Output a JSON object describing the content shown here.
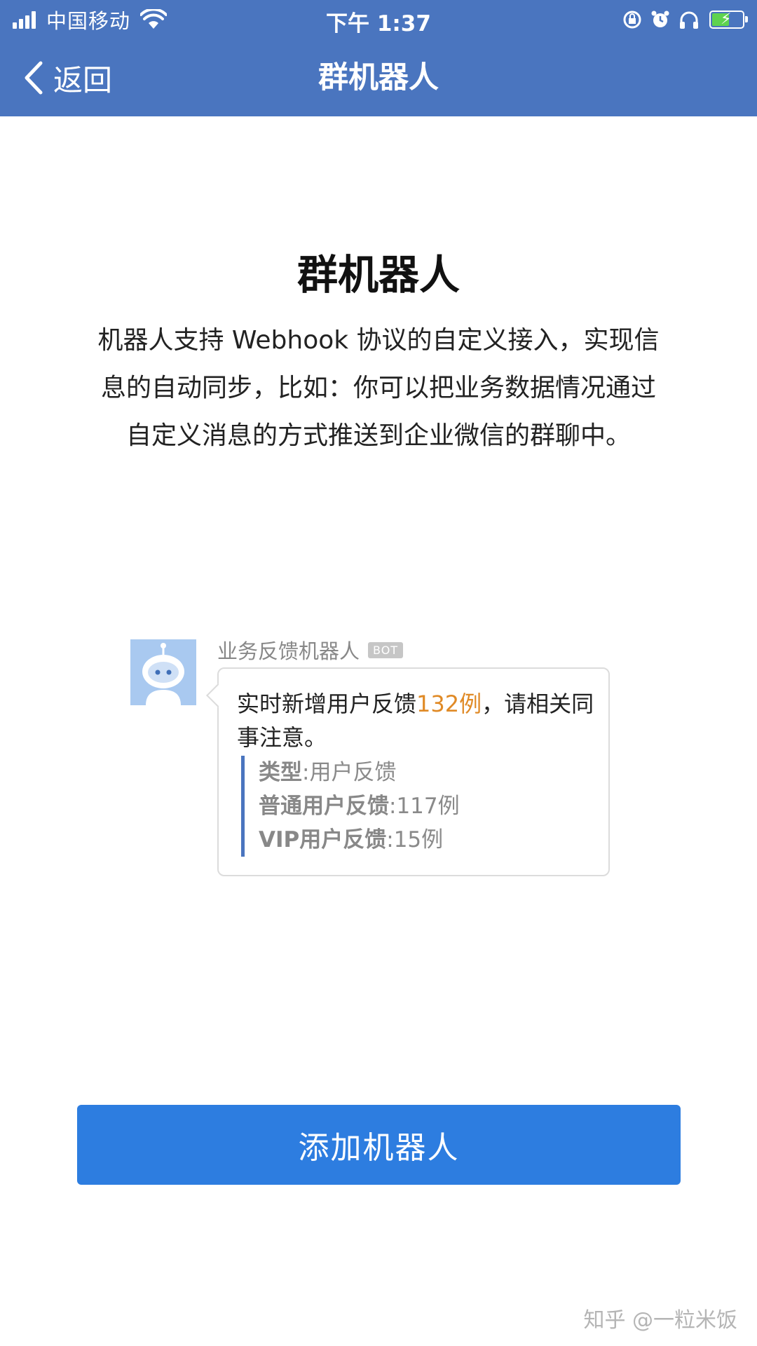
{
  "status_bar": {
    "carrier": "中国移动",
    "time": "下午 1:37",
    "icons": [
      "signal-icon",
      "wifi-icon",
      "orientation-lock-icon",
      "alarm-icon",
      "headphones-icon",
      "battery-charging-icon"
    ]
  },
  "nav": {
    "back_label": "返回",
    "title": "群机器人"
  },
  "intro": {
    "heading": "群机器人",
    "description": "机器人支持 Webhook 协议的自定义接入，实现信息的自动同步，比如：你可以把业务数据情况通过自定义消息的方式推送到企业微信的群聊中。"
  },
  "preview": {
    "sender_name": "业务反馈机器人",
    "badge": "BOT",
    "message_prefix": "实时新增用户反馈",
    "message_count": "132例",
    "message_suffix": "，请相关同事注意。",
    "quote": [
      {
        "key": "类型",
        "sep": ":",
        "value": "用户反馈"
      },
      {
        "key": "普通用户反馈",
        "sep": ":",
        "value": "117例"
      },
      {
        "key": "VIP用户反馈",
        "sep": ":",
        "value": "15例"
      }
    ]
  },
  "actions": {
    "add_label": "添加机器人"
  },
  "watermark": "知乎 @一粒米饭",
  "colors": {
    "header": "#4a75bf",
    "button": "#2d7de0",
    "highlight": "#e08a26",
    "quote_bar": "#4a75bf"
  }
}
